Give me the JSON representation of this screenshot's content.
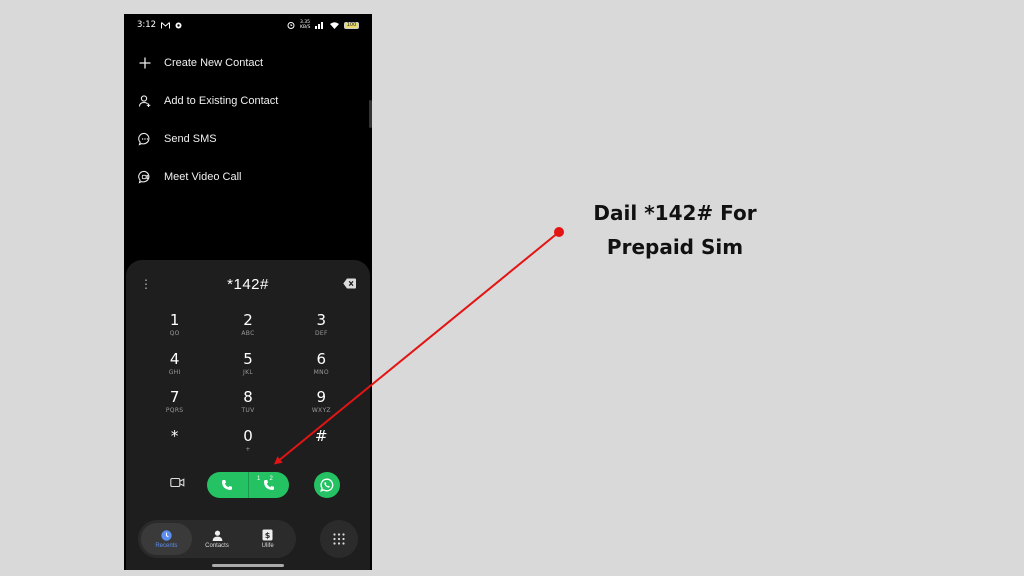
{
  "status_bar": {
    "time": "3:12",
    "network_speed": "3.35 KB/S",
    "battery": "100"
  },
  "menu": {
    "items": [
      {
        "label": "Create New Contact",
        "icon": "plus-icon"
      },
      {
        "label": "Add to Existing Contact",
        "icon": "person-add-icon"
      },
      {
        "label": "Send SMS",
        "icon": "message-icon"
      },
      {
        "label": "Meet Video Call",
        "icon": "video-call-icon"
      }
    ]
  },
  "dialer": {
    "number": "*142#",
    "keys": [
      {
        "digit": "1",
        "letters": "QO"
      },
      {
        "digit": "2",
        "letters": "ABC"
      },
      {
        "digit": "3",
        "letters": "DEF"
      },
      {
        "digit": "4",
        "letters": "GHI"
      },
      {
        "digit": "5",
        "letters": "JKL"
      },
      {
        "digit": "6",
        "letters": "MNO"
      },
      {
        "digit": "7",
        "letters": "PQRS"
      },
      {
        "digit": "8",
        "letters": "TUV"
      },
      {
        "digit": "9",
        "letters": "WXYZ"
      },
      {
        "digit": "*",
        "letters": ""
      },
      {
        "digit": "0",
        "letters": "+"
      },
      {
        "digit": "#",
        "letters": ""
      }
    ],
    "sim1_label": "1",
    "sim2_label": "2"
  },
  "bottom_nav": {
    "recents": "Recents",
    "contacts": "Contacts",
    "ulife": "Ulife"
  },
  "annotation": {
    "line1": "Dail *142# For",
    "line2": "Prepaid Sim"
  },
  "colors": {
    "call_green": "#25c263",
    "arrow_red": "#e31414",
    "accent_blue": "#5b8ef0"
  }
}
